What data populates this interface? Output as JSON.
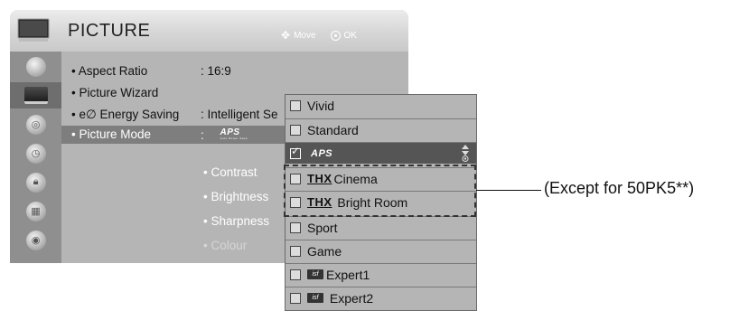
{
  "header": {
    "title": "PICTURE",
    "move_label": "Move",
    "ok_label": "OK"
  },
  "sidebar": {
    "items": [
      {
        "icon": "disc-icon"
      },
      {
        "icon": "picture-icon"
      },
      {
        "icon": "audio-icon"
      },
      {
        "icon": "time-icon"
      },
      {
        "icon": "lock-icon"
      },
      {
        "icon": "option-icon"
      },
      {
        "icon": "network-icon"
      }
    ]
  },
  "menu": {
    "rows": [
      {
        "label": "• Aspect Ratio",
        "value": ": 16:9"
      },
      {
        "label": "• Picture Wizard",
        "value": ""
      },
      {
        "label": "• e∅ Energy Saving",
        "value": ": Intelligent Se"
      },
      {
        "label": "• Picture Mode",
        "value": ":"
      }
    ],
    "picture_mode_logo": "APS",
    "picture_mode_logo_sub": "Auto Power Save",
    "sub_settings": [
      "• Contrast",
      "• Brightness",
      "• Sharpness",
      "• Colour"
    ]
  },
  "dropdown": {
    "items": [
      {
        "label": "Vivid",
        "prefix": ""
      },
      {
        "label": "Standard",
        "prefix": ""
      },
      {
        "label": "APS",
        "prefix": "",
        "selected": true
      },
      {
        "label": "Cinema",
        "prefix": "THX"
      },
      {
        "label": " Bright Room",
        "prefix": "THX"
      },
      {
        "label": "Sport",
        "prefix": ""
      },
      {
        "label": "Game",
        "prefix": ""
      },
      {
        "label": "Expert1",
        "prefix": "isf"
      },
      {
        "label": " Expert2",
        "prefix": "isf"
      }
    ]
  },
  "annotation": "(Except for 50PK5**)"
}
